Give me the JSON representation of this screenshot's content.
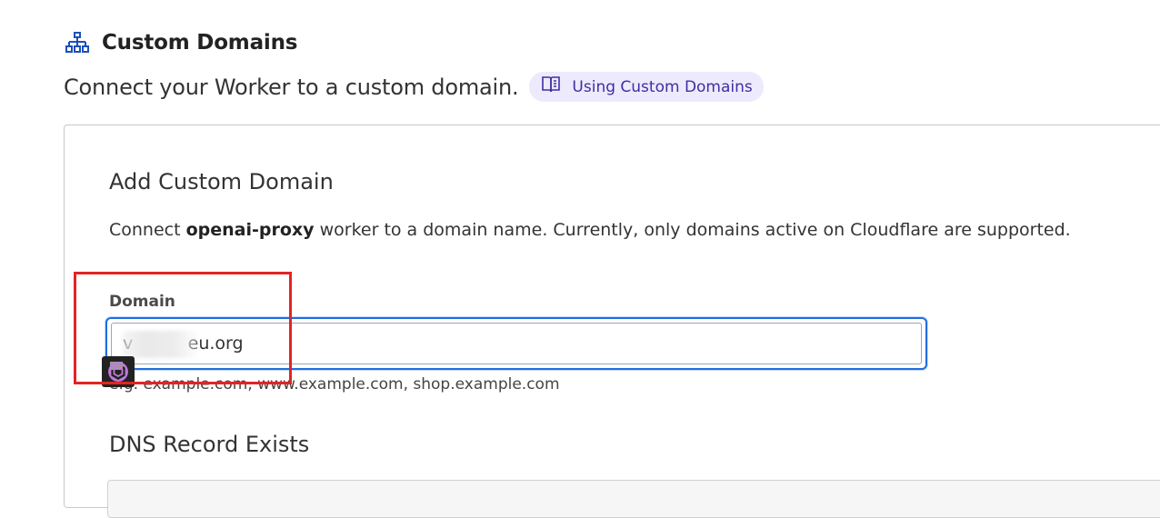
{
  "header": {
    "title": "Custom Domains",
    "icon": "sitemap-icon",
    "subtitle": "Connect your Worker to a custom domain.",
    "docs_link": {
      "label": "Using Custom Domains",
      "icon": "book-icon"
    }
  },
  "card": {
    "title": "Add Custom Domain",
    "description_prefix": "Connect ",
    "worker_name": "openai-proxy",
    "description_suffix": " worker to a domain name. Currently, only domains active on Cloudflare are supported.",
    "domain_field": {
      "label": "Domain",
      "value": "v          eu.org",
      "hint": "e.g. example.com, www.example.com, shop.example.com"
    },
    "dns_section_title": "DNS Record Exists"
  },
  "overlay": {
    "extension_icon": "chatgpt-logo-icon",
    "highlight_color": "#e32424"
  },
  "colors": {
    "accent": "#1f6ee0",
    "pill_bg": "#eeeafd",
    "pill_text": "#3d2fa3"
  }
}
